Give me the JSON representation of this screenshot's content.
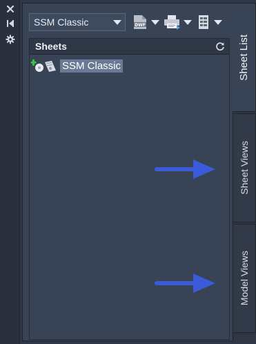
{
  "titlebar": {
    "close_icon": "close-icon",
    "autohide_icon": "auto-hide-icon",
    "properties_icon": "gear-icon"
  },
  "toolbar": {
    "sheet_set_selected": "SSM Classic",
    "publish_dwf_icon": "publish-dwf-icon",
    "publish_dwf_text": "DWF",
    "plot_icon": "printer-icon",
    "sheet_list_table_icon": "sheet-list-table-icon"
  },
  "panel": {
    "header": "Sheets",
    "refresh_icon": "refresh-icon",
    "tree": [
      {
        "label": "SSM Classic",
        "icon": "sheet-set-icon",
        "selected": true
      }
    ]
  },
  "tabs": [
    {
      "label": "Sheet List",
      "active": true
    },
    {
      "label": "Sheet Views",
      "active": false
    },
    {
      "label": "Model Views",
      "active": false
    }
  ],
  "colors": {
    "background": "#2f3646",
    "panel": "#394356",
    "selection": "#6b7996",
    "annotation_arrow": "#3b5bdb",
    "add_badge": "#3fbf3f"
  }
}
